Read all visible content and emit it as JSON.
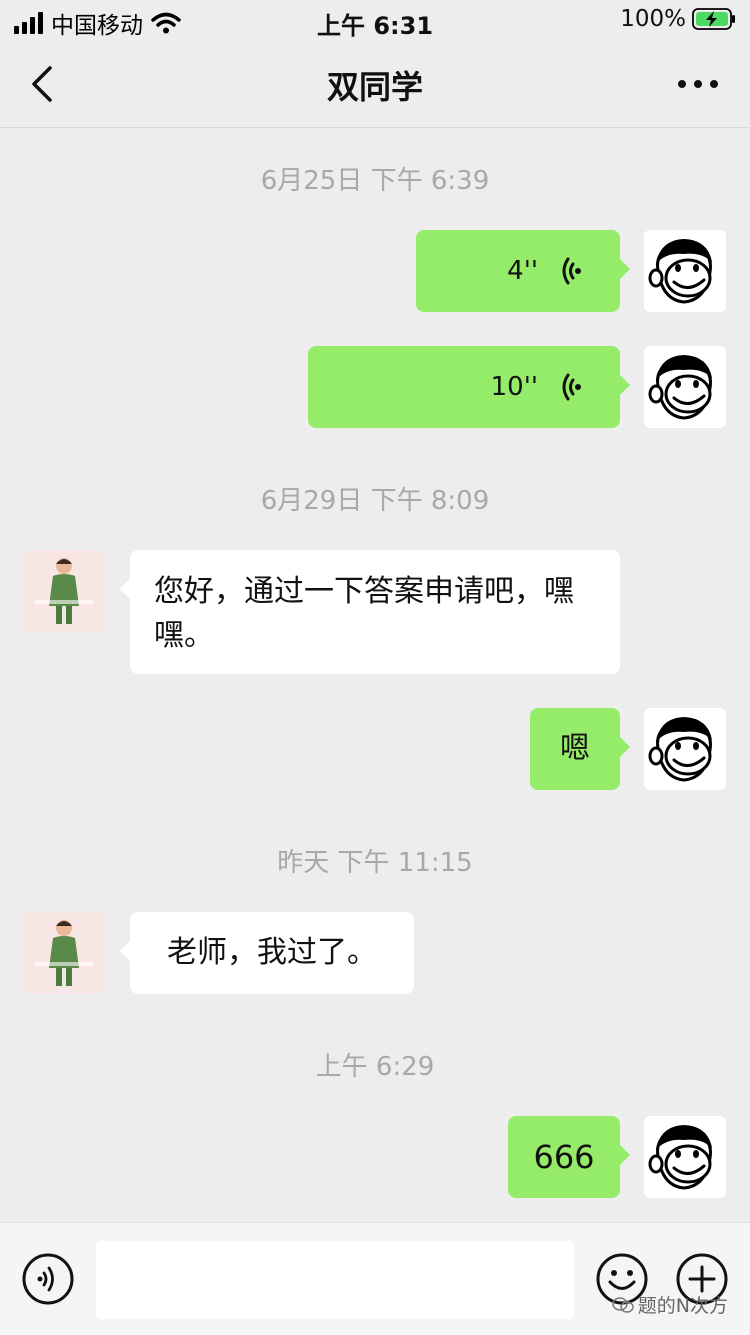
{
  "status_bar": {
    "carrier": "中国移动",
    "time": "上午 6:31",
    "battery": "100%"
  },
  "nav": {
    "title": "双同学"
  },
  "messages": [
    {
      "ts": "6月25日 下午 6:39"
    },
    {
      "voice_duration": "4''"
    },
    {
      "voice_duration": "10''"
    },
    {
      "ts": "6月29日 下午 8:09"
    },
    {
      "text": "您好，通过一下答案申请吧，嘿嘿。"
    },
    {
      "text": "嗯"
    },
    {
      "ts": "昨天 下午 11:15"
    },
    {
      "text": "老师，我过了。"
    },
    {
      "ts": "上午 6:29"
    },
    {
      "text": "666"
    }
  ],
  "watermark": "题的N次方",
  "colors": {
    "outgoing_bubble": "#95ec69",
    "incoming_bubble": "#ffffff",
    "background": "#ededed"
  },
  "icons": [
    "back-icon",
    "more-icon",
    "voice-wave-icon",
    "voice-mode-icon",
    "emoji-icon",
    "plus-icon",
    "wechat-logo-icon"
  ]
}
